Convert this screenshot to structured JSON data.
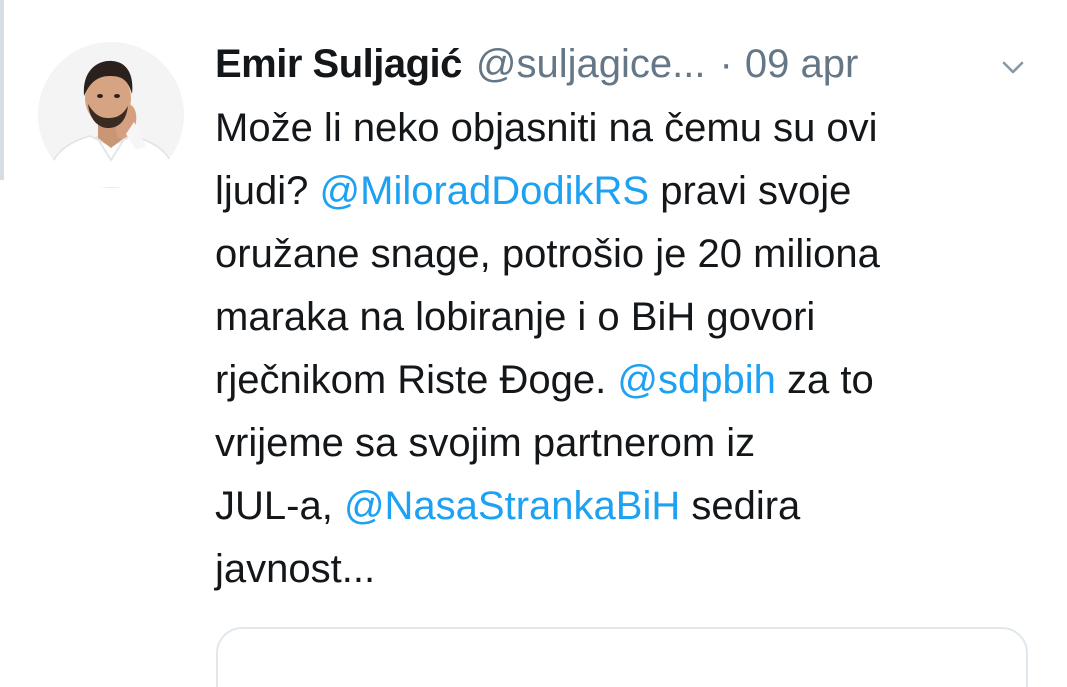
{
  "tweet": {
    "display_name": "Emir Suljagić",
    "handle": "@suljagice...",
    "separator": "·",
    "date": "09 apr",
    "avatar_icon": "profile-photo",
    "menu_icon": "chevron-down-icon",
    "colors": {
      "text": "#14171a",
      "secondary": "#657786",
      "link": "#1da1f2"
    },
    "lines": [
      [
        {
          "text": "Može li neko objasniti na čemu su ovi"
        }
      ],
      [
        {
          "text": "ljudi? "
        },
        {
          "mention": "@MiloradDodikRS"
        },
        {
          "text": " pravi svoje"
        }
      ],
      [
        {
          "text": "oružane snage, potrošio je 20 miliona"
        }
      ],
      [
        {
          "text": "maraka na lobiranje i o BiH govori"
        }
      ],
      [
        {
          "text": "rječnikom Riste Đoge. "
        },
        {
          "mention": "@sdpbih"
        },
        {
          "text": " za to"
        }
      ],
      [
        {
          "text": "vrijeme sa svojim partnerom iz"
        }
      ],
      [
        {
          "text": "JUL-a, "
        },
        {
          "mention": "@NasaStrankaBiH"
        },
        {
          "text": " sedira"
        }
      ],
      [
        {
          "text": "javnost..."
        }
      ]
    ]
  }
}
